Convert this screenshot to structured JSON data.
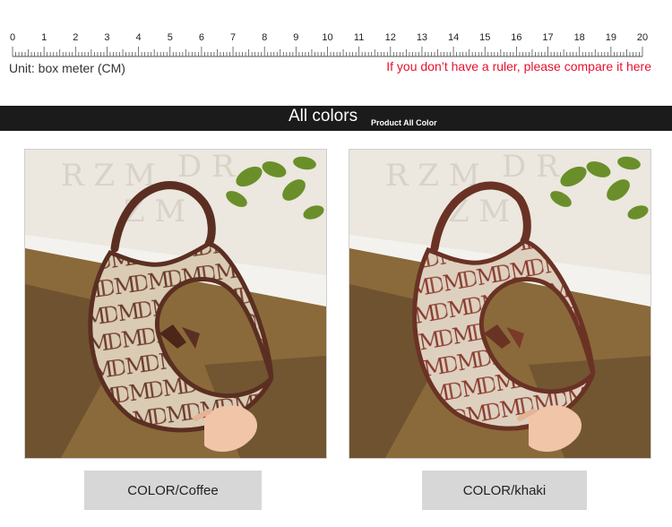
{
  "ruler": {
    "numbers": [
      "0",
      "1",
      "2",
      "3",
      "4",
      "5",
      "6",
      "7",
      "8",
      "9",
      "10",
      "11",
      "12",
      "13",
      "14",
      "15",
      "16",
      "17",
      "18",
      "19",
      "20"
    ],
    "unit_label": "Unit: box meter (CM)",
    "compare_note": "If you don’t have a ruler, please compare it here"
  },
  "banner": {
    "title": "All colors",
    "subtitle": "Product All Color"
  },
  "products": [
    {
      "color_label": "COLOR/Coffee",
      "bag_color": "#6b3a2a",
      "canvas_color": "#c8b8a0"
    },
    {
      "color_label": "COLOR/khaki",
      "bag_color": "#8a3b2e",
      "canvas_color": "#d6c8b6"
    }
  ],
  "colors": {
    "banner_bg": "#1b1b1b",
    "note_red": "#e8112d",
    "label_box": "#d7d7d7"
  }
}
